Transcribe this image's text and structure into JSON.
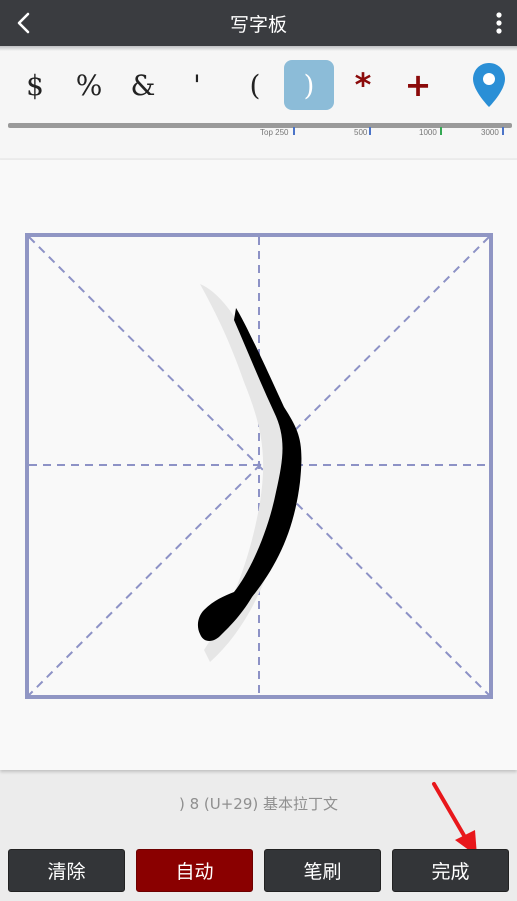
{
  "app": {
    "title": "写字板"
  },
  "char_bar": {
    "chars": [
      {
        "glyph": "$",
        "state": "normal"
      },
      {
        "glyph": "%",
        "state": "normal"
      },
      {
        "glyph": "&",
        "state": "normal"
      },
      {
        "glyph": "'",
        "state": "normal"
      },
      {
        "glyph": "(",
        "state": "normal"
      },
      {
        "glyph": ")",
        "state": "selected"
      },
      {
        "glyph": "*",
        "state": "red"
      },
      {
        "glyph": "+",
        "state": "red"
      }
    ],
    "location_icon": "map-pin-icon",
    "frequency_marks": [
      "Top 250",
      "500",
      "1000",
      "3000"
    ]
  },
  "char_info": ") 8 (U+29) 基本拉丁文",
  "buttons": {
    "clear": "清除",
    "auto": "自动",
    "brush": "笔刷",
    "done": "完成"
  },
  "colors": {
    "title_bar": "#3a3c40",
    "selected_chip": "#8cbcd8",
    "red_accent": "#8a0000",
    "grid_line": "#9096c4",
    "arrow": "#e8171b"
  }
}
